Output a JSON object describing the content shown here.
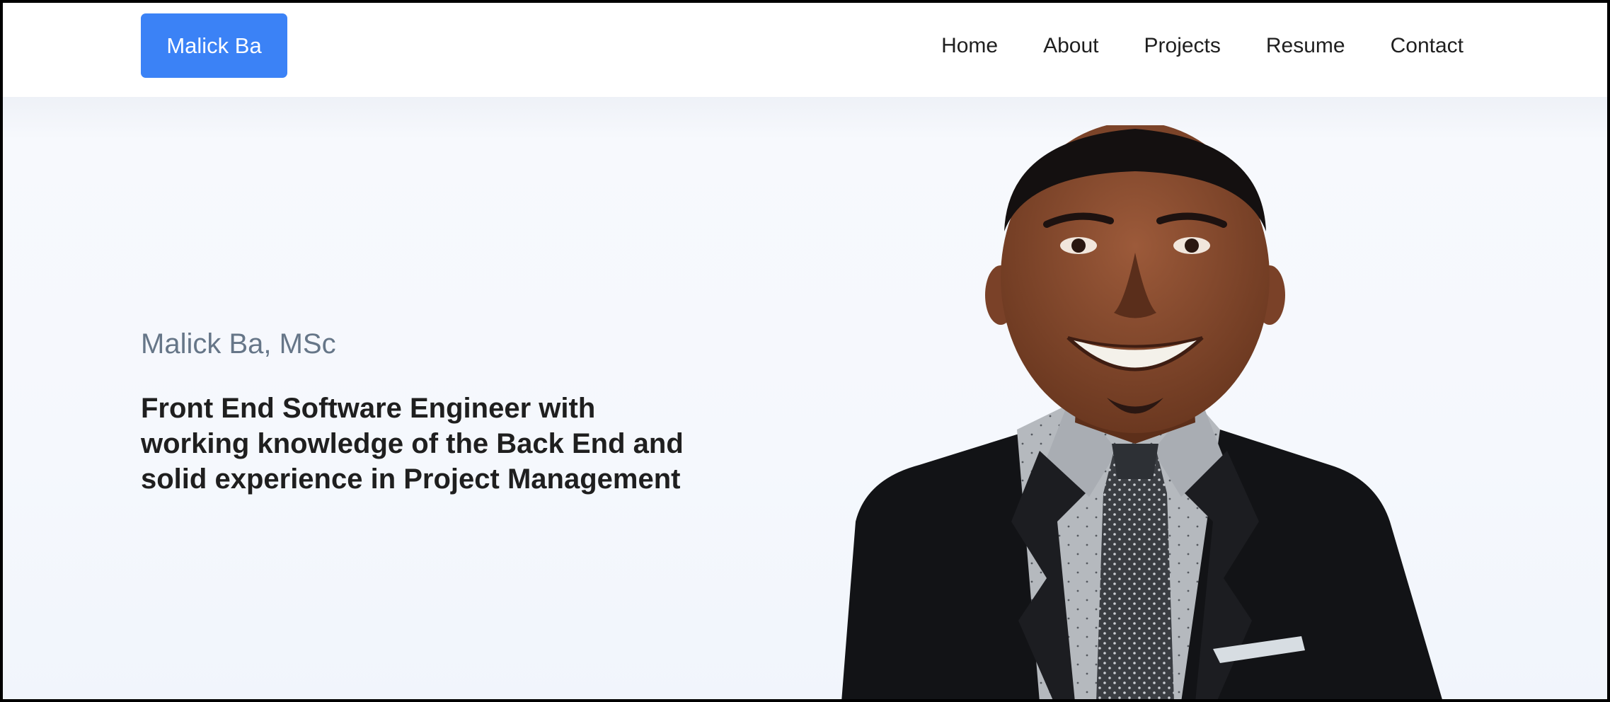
{
  "navbar": {
    "brand": "Malick Ba",
    "links": [
      "Home",
      "About",
      "Projects",
      "Resume",
      "Contact"
    ]
  },
  "hero": {
    "subtitle": "Malick Ba, MSc",
    "headline": "Front End Software Engineer with working knowledge of the Back End and solid experience in Project Management"
  },
  "colors": {
    "brand_button": "#3b82f6",
    "subtitle_text": "#667688",
    "headline_text": "#1f1f1f",
    "hero_background": "#f4f7fc"
  }
}
